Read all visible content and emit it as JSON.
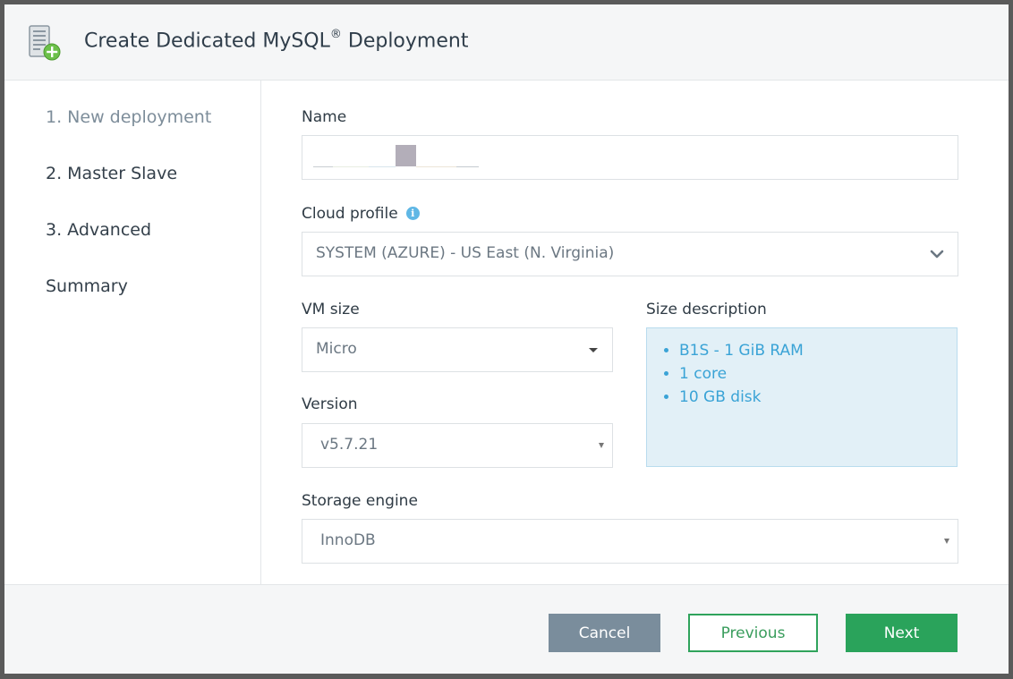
{
  "header": {
    "title": "Create Dedicated MySQL",
    "title_sup": "®",
    "title_suffix": " Deployment",
    "icon": "server-add-icon"
  },
  "sidebar": {
    "steps": [
      {
        "label": "1. New deployment",
        "active": true
      },
      {
        "label": "2. Master Slave",
        "active": false
      },
      {
        "label": "3. Advanced",
        "active": false
      },
      {
        "label": "Summary",
        "active": false
      }
    ]
  },
  "form": {
    "name": {
      "label": "Name",
      "value": ""
    },
    "cloud_profile": {
      "label": "Cloud profile",
      "value": "SYSTEM (AZURE) - US East (N. Virginia)",
      "info_icon": "info-icon"
    },
    "vm_size": {
      "label": "VM size",
      "value": "Micro"
    },
    "version": {
      "label": "Version",
      "value": "v5.7.21"
    },
    "size_description": {
      "label": "Size description",
      "items": [
        "B1S - 1 GiB RAM",
        "1 core",
        "10 GB disk"
      ]
    },
    "storage_engine": {
      "label": "Storage engine",
      "value": "InnoDB"
    }
  },
  "footer": {
    "cancel_label": "Cancel",
    "previous_label": "Previous",
    "next_label": "Next"
  },
  "colors": {
    "accent_green": "#2aa35b",
    "cancel_gray": "#7a8d9c",
    "info_blue": "#3aa3d6"
  }
}
